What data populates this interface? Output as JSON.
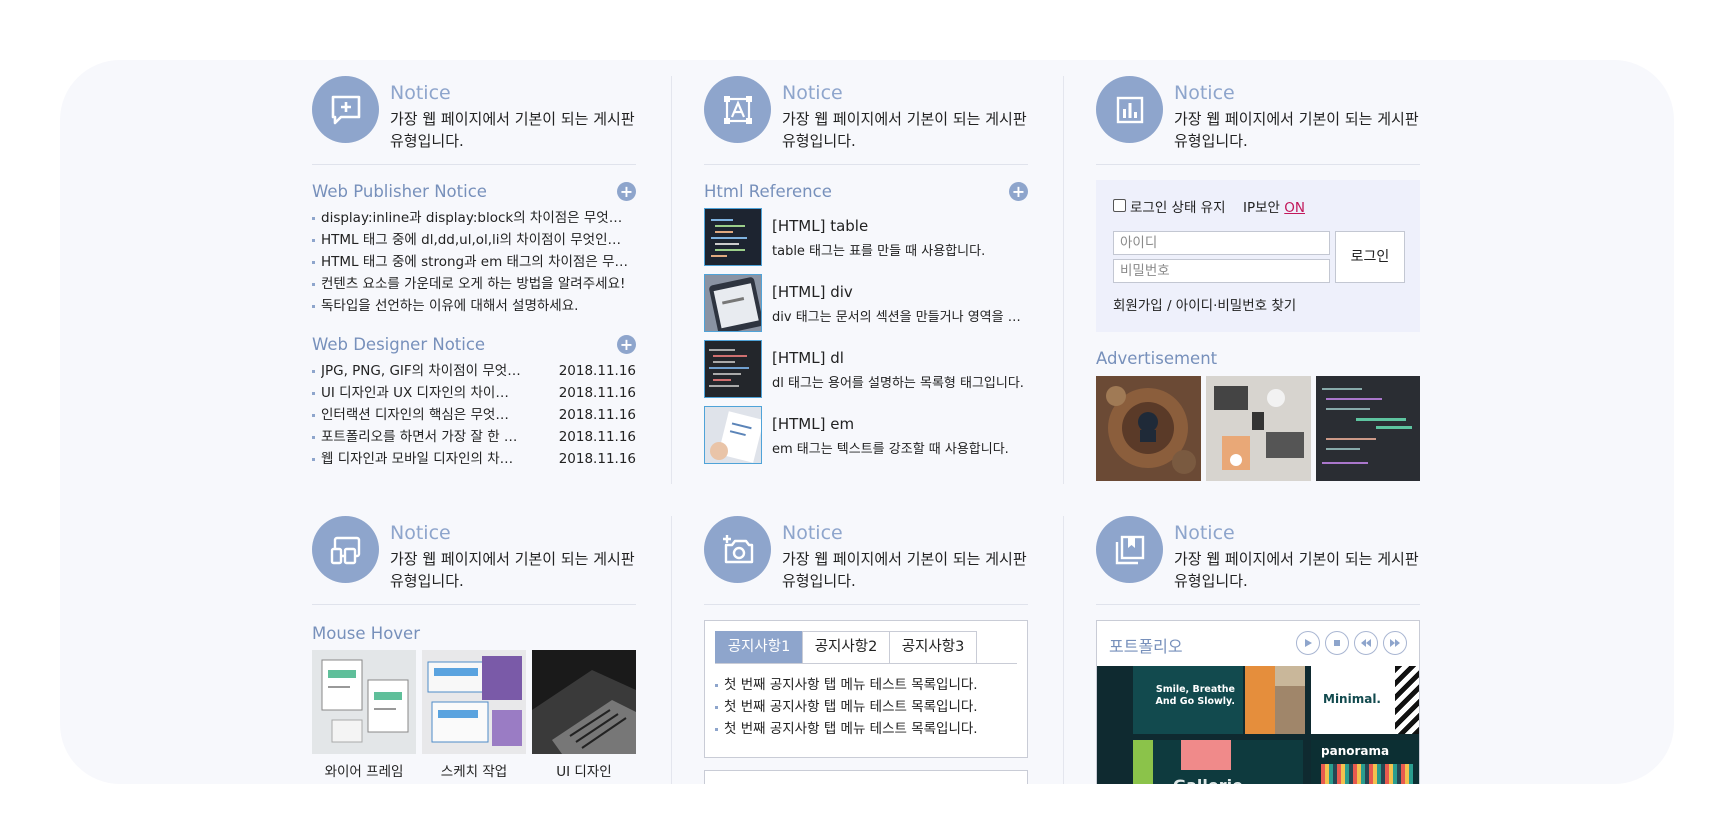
{
  "colors": {
    "accent": "#8ea5cc",
    "background": "#f7f8fc",
    "link": "#c2185b"
  },
  "notice": {
    "title": "Notice",
    "desc": "가장 웹 페이지에서 기본이 되는 게시판 유형입니다."
  },
  "icons": [
    "add-comment-icon",
    "font-frame-icon",
    "bar-chart-icon",
    "devices-icon",
    "add-camera-icon",
    "book-icon"
  ],
  "publisher": {
    "title": "Web Publisher Notice",
    "items": [
      "display:inline과 display:block의 차이점은 무엇인가요?",
      "HTML 태그 중에 dl,dd,ul,ol,li의 차이점이 무엇인가요?",
      "HTML 태그 중에 strong과 em 태그의 차이점은 무엇인가요?",
      "컨텐츠 요소를 가운데로 오게 하는 방법을 알려주세요!",
      "독타입을 선언하는 이유에 대해서 설명하세요."
    ]
  },
  "designer": {
    "title": "Web Designer Notice",
    "items": [
      {
        "text": "JPG, PNG, GIF의 차이점이 무엇인가요?",
        "date": "2018.11.16"
      },
      {
        "text": "UI 디자인과 UX 디자인의 차이점은?",
        "date": "2018.11.16"
      },
      {
        "text": "인터랙션 디자인의 핵심은 무엇인가요?",
        "date": "2018.11.16"
      },
      {
        "text": "포트폴리오를 하면서 가장 잘 한 점은?",
        "date": "2018.11.16"
      },
      {
        "text": "웹 디자인과 모바일 디자인의 차이점은?",
        "date": "2018.11.16"
      }
    ]
  },
  "reference": {
    "title": "Html Reference",
    "items": [
      {
        "title": "[HTML] table",
        "desc": "table 태그는 표를 만들 때 사용합니다."
      },
      {
        "title": "[HTML] div",
        "desc": "div 태그는 문서의 섹션을 만들거나 영역을 나눌 때 사용합니다."
      },
      {
        "title": "[HTML] dl",
        "desc": "dl 태그는 용어를 설명하는 목록형 태그입니다."
      },
      {
        "title": "[HTML] em",
        "desc": "em 태그는 텍스트를 강조할 때 사용합니다."
      }
    ]
  },
  "login": {
    "keep": "로그인 상태 유지",
    "ip_label": "IP보안",
    "ip_state": "ON",
    "id_placeholder": "아이디",
    "pw_placeholder": "비밀번호",
    "button": "로그인",
    "links": "회원가입 / 아이디·비밀번호 찾기"
  },
  "ad": {
    "title": "Advertisement"
  },
  "hover": {
    "title": "Mouse Hover",
    "items": [
      "와이어 프레임",
      "스케치 작업",
      "UI 디자인"
    ]
  },
  "tabs": {
    "labels": [
      "공지사항1",
      "공지사항2",
      "공지사항3"
    ],
    "active": 0,
    "items": [
      "첫 번째 공지사항 탭 메뉴 테스트 목록입니다.",
      "첫 번째 공지사항 탭 메뉴 테스트 목록입니다.",
      "첫 번째 공지사항 탭 메뉴 테스트 목록입니다."
    ]
  },
  "portfolio": {
    "title": "포트폴리오",
    "controls": [
      "play-icon",
      "stop-icon",
      "prev-icon",
      "next-icon"
    ],
    "cards": [
      "Smile, Breathe And Go Slowly.",
      "Minimal.",
      "panorama",
      "Gallerie"
    ]
  }
}
